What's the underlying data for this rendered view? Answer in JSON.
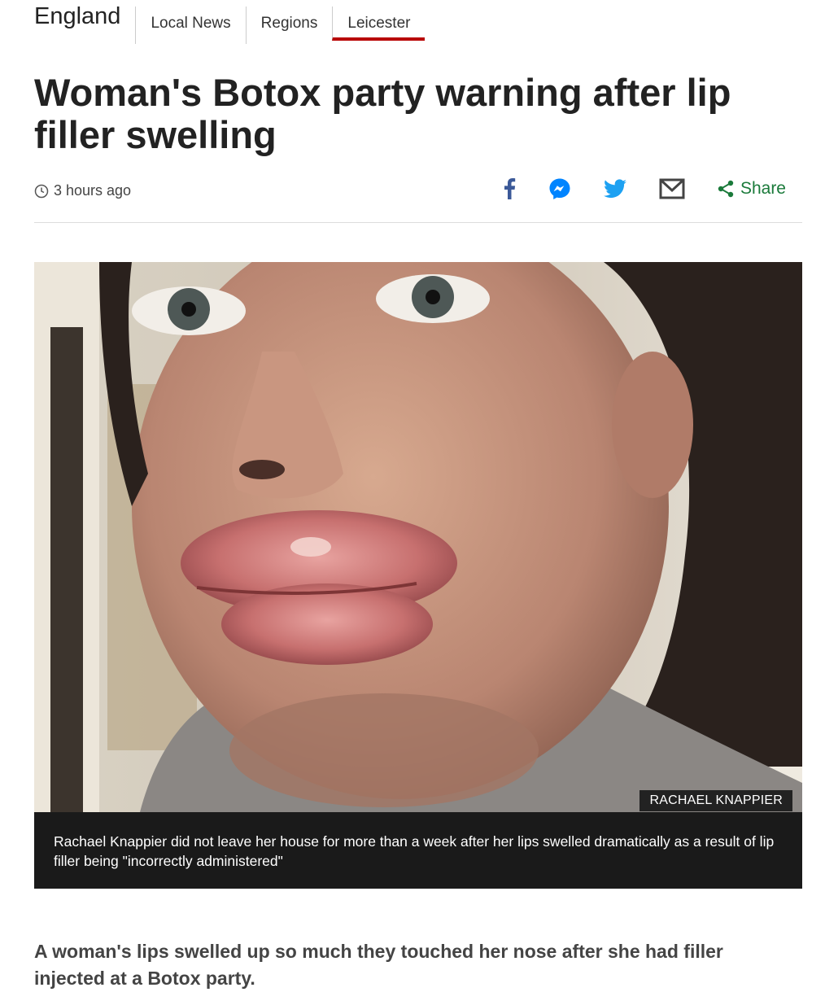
{
  "nav": {
    "section": "England",
    "items": [
      {
        "label": "Local News",
        "active": false
      },
      {
        "label": "Regions",
        "active": false
      },
      {
        "label": "Leicester",
        "active": true
      }
    ]
  },
  "article": {
    "headline": "Woman's Botox party warning after lip filler swelling",
    "timestamp": "3 hours ago",
    "share_label": "Share",
    "image_credit": "RACHAEL KNAPPIER",
    "caption": "Rachael Knappier did not leave her house for more than a week after her lips swelled dramatically as a result of lip filler being \"incorrectly administered\"",
    "lede": "A woman's lips swelled up so much they touched her nose after she had filler injected at a Botox party."
  },
  "share_icons": [
    "facebook-icon",
    "messenger-icon",
    "twitter-icon",
    "email-icon",
    "share-icon"
  ],
  "colors": {
    "active_tab_underline": "#b80000",
    "share_green": "#1a7a3a",
    "facebook": "#3b5998",
    "messenger": "#0084ff",
    "twitter": "#1da1f2",
    "caption_bg": "#1a1a1a"
  }
}
